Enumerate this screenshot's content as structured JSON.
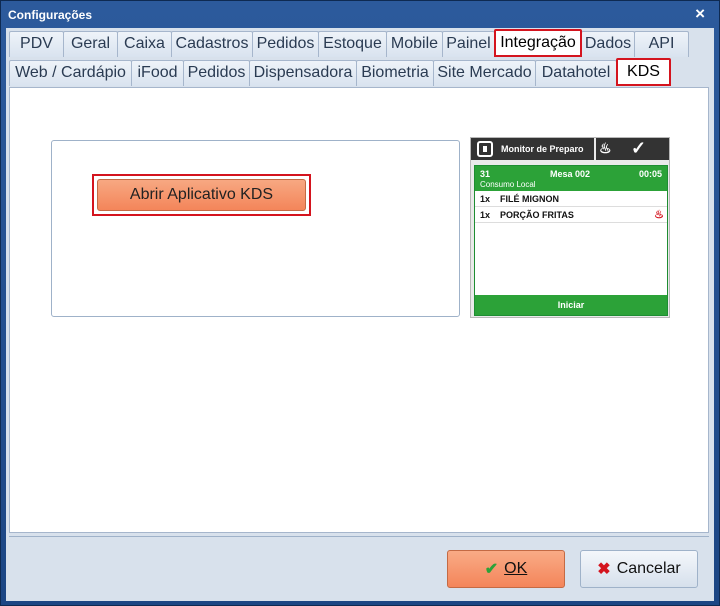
{
  "window": {
    "title": "Configurações"
  },
  "tabs_main": [
    "PDV",
    "Geral",
    "Caixa",
    "Cadastros",
    "Pedidos",
    "Estoque",
    "Mobile",
    "Painel",
    "Integração",
    "Dados",
    "API"
  ],
  "tabs_main_active": "Integração",
  "tabs_sub": [
    "Web / Cardápio",
    "iFood",
    "Pedidos",
    "Dispensadora",
    "Biometria",
    "Site Mercado",
    "Datahotel",
    "KDS"
  ],
  "tabs_sub_active": "KDS",
  "kds": {
    "open_button": "Abrir Aplicativo KDS"
  },
  "preview": {
    "header_title": "Monitor de Preparo",
    "order_number": "31",
    "table": "Mesa 002",
    "time": "00:05",
    "consumption": "Consumo Local",
    "items": [
      {
        "qty": "1x",
        "name": "FILÉ MIGNON",
        "icon": ""
      },
      {
        "qty": "1x",
        "name": "PORÇÃO FRITAS",
        "icon": "cooking-pot-icon"
      }
    ],
    "start_button": "Iniciar"
  },
  "buttons": {
    "ok": "OK",
    "cancel": "Cancelar"
  },
  "colors": {
    "accent": "#f4855a",
    "highlight": "#d4141e",
    "green": "#2ca238"
  }
}
